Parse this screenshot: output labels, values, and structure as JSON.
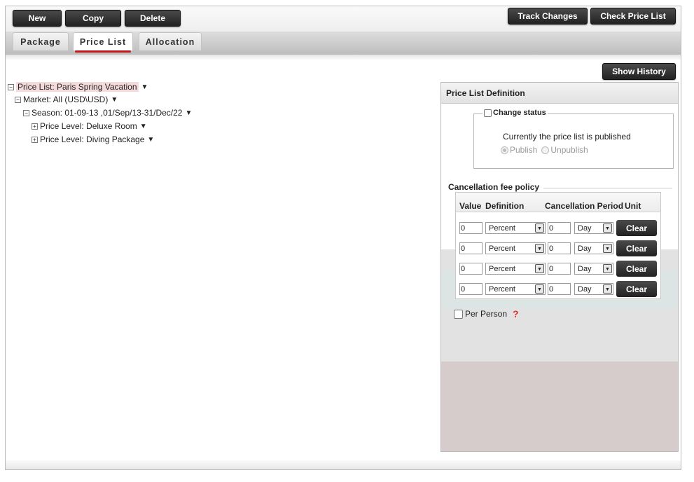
{
  "toolbar": {
    "left_buttons": [
      "New",
      "Copy",
      "Delete"
    ],
    "track_changes": "Track Changes",
    "check_price_list": "Check Price List"
  },
  "tabs": [
    "Package",
    "Price List",
    "Allocation"
  ],
  "active_tab": "Price List",
  "show_history": "Show History",
  "tree": {
    "root": {
      "toggle": "−",
      "label": "Price List: Paris Spring Vacation",
      "arrow": "▼"
    },
    "market": {
      "toggle": "−",
      "label": "Market: All (USD\\USD)",
      "arrow": "▼"
    },
    "season": {
      "toggle": "−",
      "label": "Season: 01-09-13 ,01/Sep/13-31/Dec/22",
      "arrow": "▼"
    },
    "level1": {
      "toggle": "+",
      "label": "Price Level: Deluxe Room",
      "arrow": "▼"
    },
    "level2": {
      "toggle": "+",
      "label": "Price Level: Diving Package",
      "arrow": "▼"
    }
  },
  "panel": {
    "title": "Price List Definition",
    "change_status_label": "Change status",
    "status_text": "Currently the price list is published",
    "publish_label": "Publish",
    "unpublish_label": "Unpublish",
    "cancellation_title": "Cancellation fee policy",
    "columns": {
      "value": "Value",
      "definition": "Definition",
      "cancellation_period": "Cancellation Period",
      "unit": "Unit"
    },
    "rows": [
      {
        "value": "0",
        "definition": "Percent",
        "period": "0",
        "unit": "Day",
        "clear": "Clear"
      },
      {
        "value": "0",
        "definition": "Percent",
        "period": "0",
        "unit": "Day",
        "clear": "Clear"
      },
      {
        "value": "0",
        "definition": "Percent",
        "period": "0",
        "unit": "Day",
        "clear": "Clear"
      },
      {
        "value": "0",
        "definition": "Percent",
        "period": "0",
        "unit": "Day",
        "clear": "Clear"
      }
    ],
    "per_person_label": "Per Person",
    "help_icon": "question-icon"
  },
  "colors": {
    "accent": "#c0171b",
    "button": "#2a2a2a",
    "tree_highlight": "#f4dada"
  }
}
